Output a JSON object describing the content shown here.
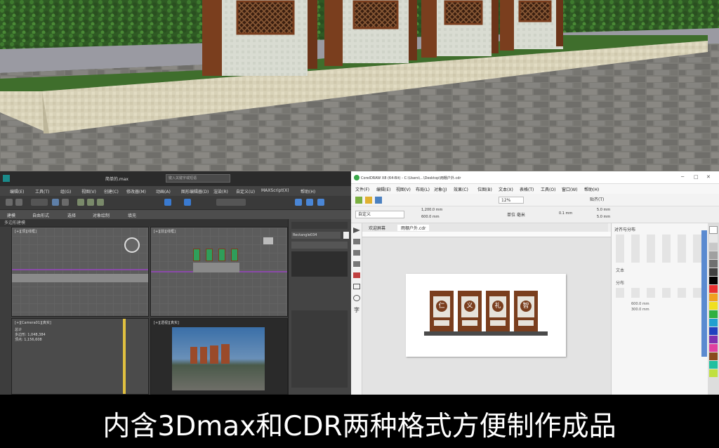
{
  "caption": "内含3Dmax和CDR两种格式方便制作成品",
  "max_window": {
    "title": "简单的.max",
    "search_placeholder": "键入关键字或短语",
    "menus": [
      "编辑(E)",
      "工具(T)",
      "组(G)",
      "视图(V)",
      "创建(C)",
      "修改器(M)",
      "动画(A)",
      "图形编辑器(D)",
      "渲染(R)",
      "自定义(U)",
      "MAXScript(X)",
      "帮助(H)"
    ],
    "ribbon_tabs": [
      "建模",
      "自由形式",
      "选择",
      "对象绘制",
      "填充"
    ],
    "sub_label": "多边形建模",
    "viewports": {
      "top_left": "[+][顶][线框]",
      "top_right": "[+][前][线框]",
      "bottom_left": "[+][Camera01][真实]",
      "bottom_right": "[+][透视][真实]"
    },
    "modifier_name": "Rectangle034",
    "stats": [
      "总计",
      "多边形: 1,048,384",
      "顶点: 1,156,608"
    ]
  },
  "cdr_window": {
    "title": "CorelDRAW X8 (64-Bit) - C:\\Users\\...\\Desktop\\雨棚户外.cdr",
    "menus": [
      "文件(F)",
      "编辑(E)",
      "视图(V)",
      "布局(L)",
      "对象(J)",
      "效果(C)",
      "位图(B)",
      "文本(X)",
      "表格(T)",
      "工具(O)",
      "窗口(W)",
      "帮助(H)"
    ],
    "zoom": "12%",
    "snap_label": "贴齐(T)",
    "page_size_w": "1,200.0 mm",
    "page_size_h": "600.0 mm",
    "units": "单位 毫米",
    "nudge": "0.1 mm",
    "dup_x": "5.0 mm",
    "dup_y": "5.0 mm",
    "preset": "自定义",
    "tabs": [
      "欢迎屏幕",
      "雨棚户外.cdr"
    ],
    "docker_title": "对齐与分布",
    "docker_text": "文本",
    "docker_dist": "分布",
    "docker_val1": "600.0 mm",
    "docker_val2": "300.0 mm",
    "glyphs": [
      "仁",
      "义",
      "礼",
      "智"
    ]
  },
  "colors": {
    "board_brown": "#7a3e1e",
    "board_panel": "#e6e2da",
    "cdr_base": "#4a4a4a",
    "max_bg": "#3d3d3d"
  }
}
